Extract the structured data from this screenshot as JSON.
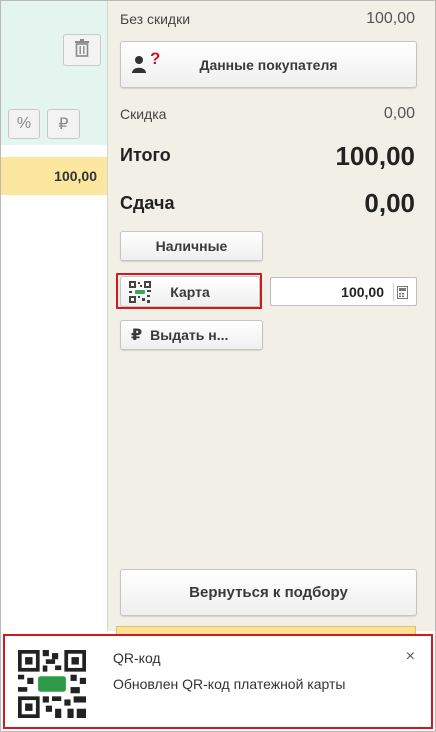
{
  "left": {
    "trash_icon": "trash-icon",
    "percent_label": "%",
    "ruble_label": "₽",
    "line_amount": "100,00"
  },
  "summary": {
    "no_discount_label": "Без скидки",
    "no_discount_value": "100,00",
    "discount_label": "Скидка",
    "discount_value": "0,00",
    "total_label": "Итого",
    "total_value": "100,00",
    "change_label": "Сдача",
    "change_value": "0,00"
  },
  "buttons": {
    "buyer_label": "Данные покупателя",
    "buyer_icon_mark": "?",
    "cash_label": "Наличные",
    "card_label": "Карта",
    "card_amount": "100,00",
    "give_label": "Выдать н...",
    "give_icon": "₽",
    "return_label": "Вернуться к подбору"
  },
  "notification": {
    "title": "QR-код",
    "message": "Обновлен QR-код платежной карты",
    "close": "×"
  },
  "colors": {
    "accent_red": "#d0191f",
    "left_panel_bg": "#e4f4ef",
    "highlight_yellow": "#fbe7a0",
    "right_panel_bg": "#f2f0e6"
  }
}
